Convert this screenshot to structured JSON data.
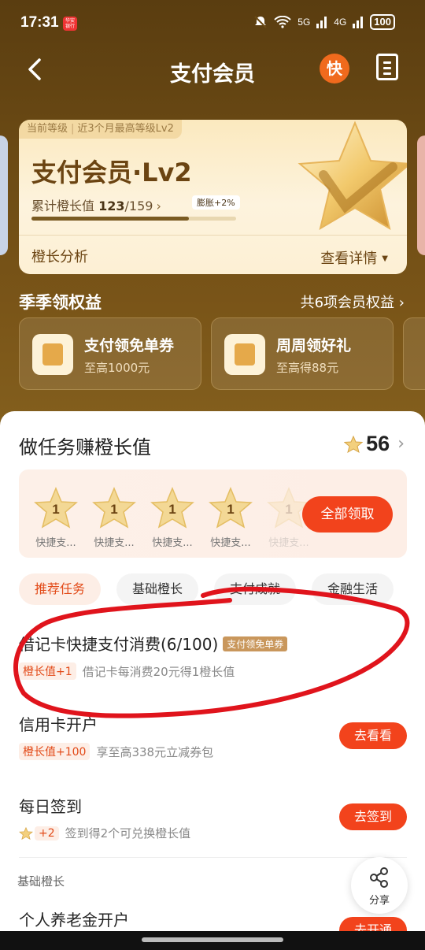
{
  "status": {
    "time": "17:31",
    "app_badge": "华安\n银行",
    "net1": "5G",
    "net2": "4G",
    "battery": "100"
  },
  "header": {
    "title": "支付会员",
    "badge": "快"
  },
  "level": {
    "tag_current": "当前等级",
    "tag_history": "近3个月最高等级Lv2",
    "name": "支付会员·Lv2",
    "growth_prefix": "累计橙长值",
    "growth_current": "123",
    "growth_total": "/159",
    "boost": "膨胀+2%",
    "progress": 0.77,
    "analysis": "橙长分析",
    "details": "查看详情"
  },
  "benefits": {
    "title": "季季领权益",
    "more": "共6项会员权益",
    "items": [
      {
        "name": "支付领免单券",
        "sub": "至高1000元"
      },
      {
        "name": "周周领好礼",
        "sub": "至高得88元"
      }
    ]
  },
  "tasks_header": {
    "title": "做任务赚橙长值",
    "points": "56"
  },
  "stars": [
    {
      "value": "1",
      "label": "快捷支..."
    },
    {
      "value": "1",
      "label": "快捷支..."
    },
    {
      "value": "1",
      "label": "快捷支..."
    },
    {
      "value": "1",
      "label": "快捷支..."
    },
    {
      "value": "1",
      "label": "快捷支..."
    }
  ],
  "claim_all": "全部领取",
  "tabs": [
    "推荐任务",
    "基础橙长",
    "支付成就",
    "金融生活"
  ],
  "tasks": [
    {
      "name": "借记卡快捷支付消费(6/100)",
      "voucher": "支付领免单券",
      "reward": "橙长值+1",
      "desc": "借记卡每消费20元得1橙长值",
      "button": ""
    },
    {
      "name": "信用卡开户",
      "reward": "橙长值+100",
      "desc": "享至高338元立减券包",
      "button": "去看看"
    },
    {
      "name": "每日签到",
      "reward": "+2",
      "desc": "签到得2个可兑换橙长值",
      "button": "去签到"
    }
  ],
  "section_label": "基础橙长",
  "last_task": {
    "name": "个人养老金开户",
    "button": "去开通"
  },
  "share": "分享",
  "colors": {
    "accent": "#f2431c",
    "brown": "#6b4a14",
    "annotation": "#e0141c"
  }
}
